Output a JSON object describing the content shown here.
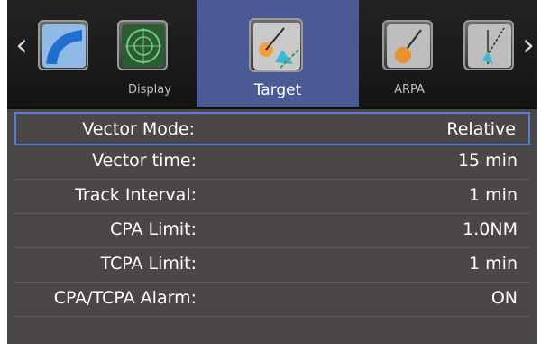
{
  "topbar": {
    "nav_prev_icon": "chevron-left-icon",
    "nav_next_icon": "chevron-right-icon",
    "tabs": [
      {
        "label": "",
        "icon": "curve-icon"
      },
      {
        "label": "Display",
        "icon": "radar-display-icon"
      },
      {
        "label": "Target",
        "icon": "target-vector-icon",
        "active": true
      },
      {
        "label": "ARPA",
        "icon": "arpa-icon"
      },
      {
        "label": "",
        "icon": "bearing-line-icon"
      }
    ],
    "active_color": "#4b5a95"
  },
  "settings": [
    {
      "label": "Vector Mode:",
      "value": "Relative",
      "selected": true
    },
    {
      "label": "Vector time:",
      "value": "15 min"
    },
    {
      "label": "Track Interval:",
      "value": "1 min"
    },
    {
      "label": "CPA Limit:",
      "value": "1.0NM"
    },
    {
      "label": "TCPA Limit:",
      "value": "1 min"
    },
    {
      "label": "CPA/TCPA Alarm:",
      "value": "ON"
    }
  ]
}
